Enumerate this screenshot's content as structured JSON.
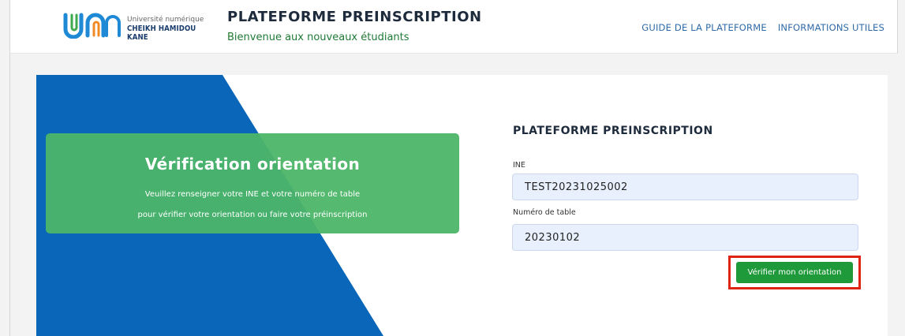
{
  "header": {
    "logo": {
      "line1": "Université numérique",
      "line2": "CHEIKH HAMIDOU KANE"
    },
    "title": "PLATEFORME PREINSCRIPTION",
    "subtitle": "Bienvenue aux nouveaux étudiants",
    "nav": [
      {
        "label": "GUIDE DE LA PLATEFORME"
      },
      {
        "label": "INFORMATIONS UTILES"
      }
    ]
  },
  "hero": {
    "title": "Vérification orientation",
    "line1": "Veuillez renseigner votre INE et votre numéro de table",
    "line2": "pour vérifier votre orientation ou faire votre préinscription"
  },
  "form": {
    "title": "PLATEFORME PREINSCRIPTION",
    "ine_label": "INE",
    "ine_value": "TEST20231025002",
    "table_label": "Numéro de table",
    "table_value": "20230102",
    "submit_label": "Vérifier mon orientation"
  },
  "colors": {
    "blue": "#0a66b8",
    "green": "#4cb568",
    "button_green": "#1f9a3a",
    "highlight_red": "#e02414",
    "link_blue": "#2f6aa8"
  }
}
